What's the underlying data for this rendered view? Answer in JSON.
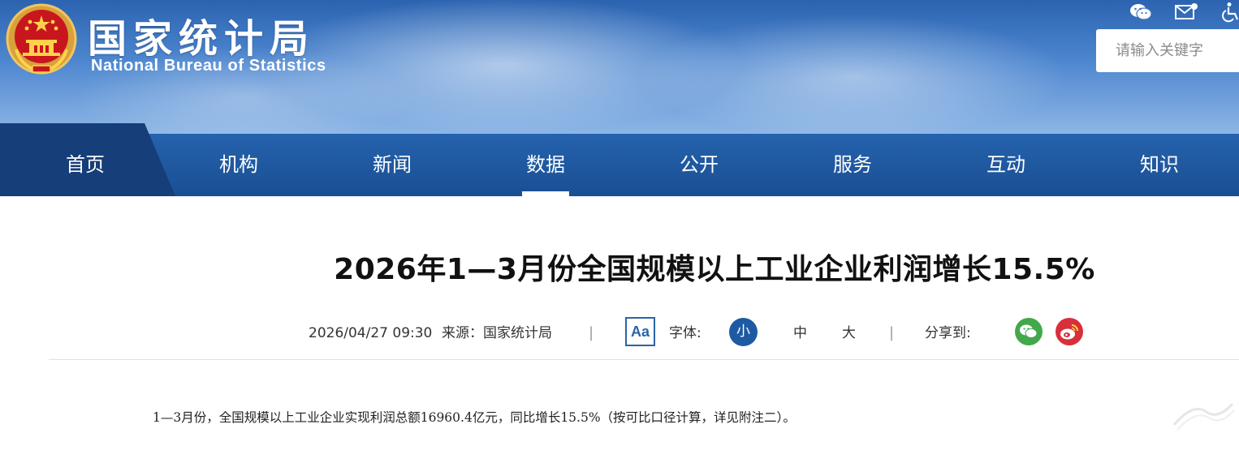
{
  "header": {
    "site_name_cn": "国家统计局",
    "site_name_en": "National Bureau of Statistics",
    "search_placeholder": "请输入关键字",
    "icons": [
      "wechat-icon",
      "email-icon",
      "accessibility-icon"
    ]
  },
  "nav": {
    "items": [
      "首页",
      "机构",
      "新闻",
      "数据",
      "公开",
      "服务",
      "互动",
      "知识"
    ],
    "active": "数据"
  },
  "article": {
    "title": "2026年1—3月份全国规模以上工业企业利润增长15.5%",
    "date": "2026/04/27 09:30",
    "source": "来源：国家统计局",
    "separator": "|",
    "font_toggle": "Aa",
    "font_label": "字体:",
    "font_sizes": [
      "小",
      "中",
      "大"
    ],
    "active_font_size": "小",
    "share_label": "分享到:",
    "first_paragraph": "1—3月份，全国规模以上工业企业实现利润总额16960.4亿元，同比增长15.5%（按可比口径计算，详见附注二）。"
  },
  "colors": {
    "nav_bg": "#2563ad",
    "nav_home_bg": "#163e79",
    "accent_blue": "#1e5aa3",
    "wechat_green": "#43a84c",
    "weibo_red": "#d8303a"
  }
}
